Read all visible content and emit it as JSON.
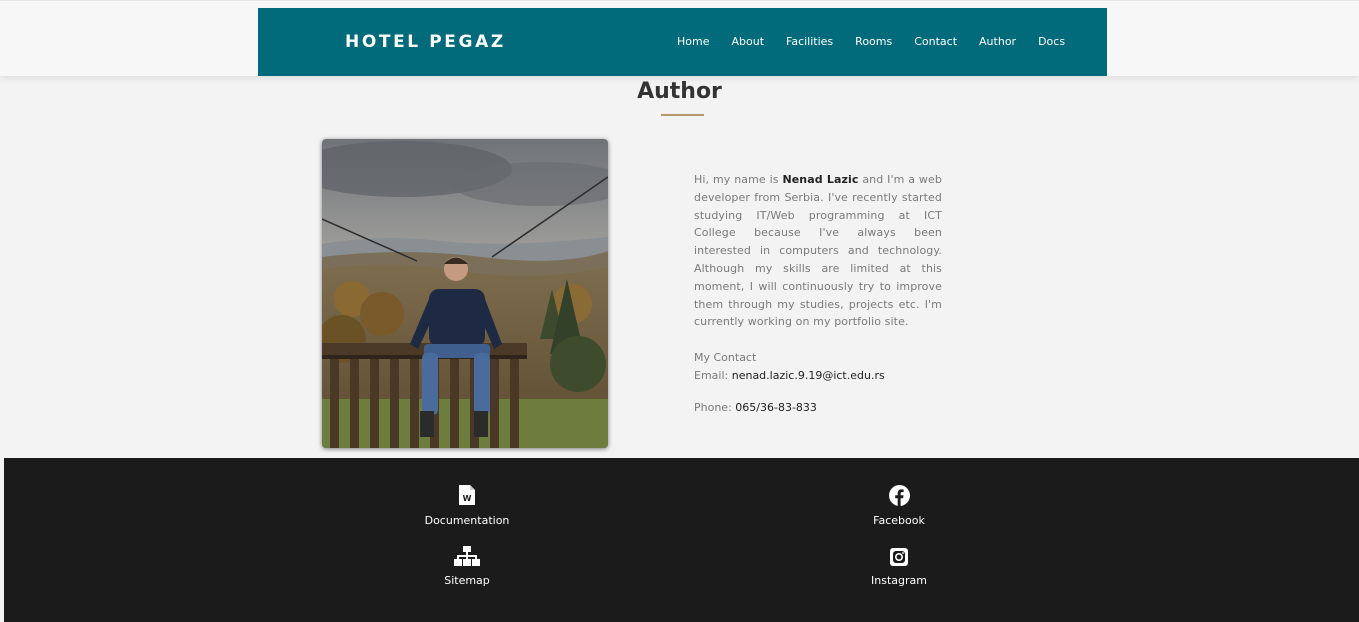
{
  "brand": "HOTEL PEGAZ",
  "colors": {
    "nav_bg": "#016a7b",
    "accent": "#b29a6d",
    "footer_bg": "#1b1b1b"
  },
  "nav": {
    "items": [
      "Home",
      "About",
      "Facilities",
      "Rooms",
      "Contact",
      "Author",
      "Docs"
    ]
  },
  "page": {
    "title": "Author"
  },
  "author": {
    "bio_intro": "Hi, my name is ",
    "name": "Nenad Lazic",
    "bio_rest": " and I'm a web developer from Serbia. I've recently started studying IT/Web programming at ICT College because I've always been interested in computers and technology. Although my skills are limited at this moment, I will continuously try to improve them through my studies, projects etc. I'm currently working on my portfolio site.",
    "contact_heading": "My Contact",
    "email_label": "Email: ",
    "email": "nenad.lazic.9.19@ict.edu.rs",
    "phone_label": "Phone: ",
    "phone": "065/36-83-833"
  },
  "footer": {
    "documentation": "Documentation",
    "sitemap": "Sitemap",
    "facebook": "Facebook",
    "instagram": "Instagram",
    "icons": {
      "documentation": "word-document-icon",
      "sitemap": "sitemap-icon",
      "facebook": "facebook-icon",
      "instagram": "instagram-icon"
    }
  }
}
